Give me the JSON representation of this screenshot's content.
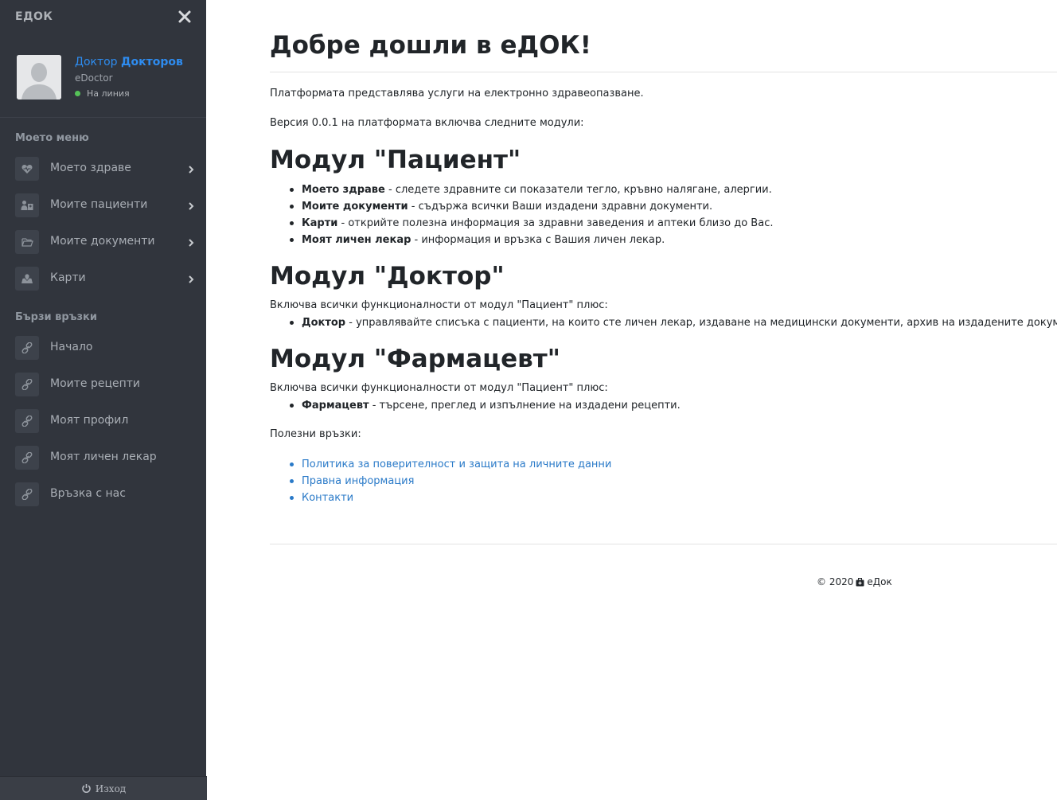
{
  "sidebar": {
    "brand": "ЕДОК",
    "profile": {
      "first_name": "Доктор",
      "last_name": "Докторов",
      "role": "eDoctor",
      "status": "На линия"
    },
    "menu_title": "Моето меню",
    "menu_items": [
      {
        "label": "Моето здраве",
        "icon": "heart-icon"
      },
      {
        "label": "Моите пациенти",
        "icon": "patients-icon"
      },
      {
        "label": "Моите документи",
        "icon": "folder-icon"
      },
      {
        "label": "Карти",
        "icon": "map-icon"
      }
    ],
    "links_title": "Бързи връзки",
    "quick_links": [
      {
        "label": "Начало",
        "icon": "link-icon"
      },
      {
        "label": "Моите рецепти",
        "icon": "link-icon"
      },
      {
        "label": "Моят профил",
        "icon": "link-icon"
      },
      {
        "label": "Моят личен лекар",
        "icon": "link-icon"
      },
      {
        "label": "Връзка с нас",
        "icon": "link-icon"
      }
    ],
    "logout": "Изход"
  },
  "main": {
    "title": "Добре дошли в еДОК!",
    "intro": "Платформата представлява услуги на електронно здравеопазване.",
    "version_text": "Версия 0.0.1 на платформата включва следните модули:",
    "patient_module": {
      "title": "Модул \"Пациент\"",
      "items": [
        {
          "bold": "Моето здраве",
          "text": " - следете здравните си показатели тегло, кръвно налягане, алергии."
        },
        {
          "bold": "Моите документи",
          "text": " - съдържа всички Ваши издадени здравни документи."
        },
        {
          "bold": "Карти",
          "text": " - открийте полезна информация за здравни заведения и аптеки близо до Вас."
        },
        {
          "bold": "Моят личен лекар",
          "text": " - информация и връзка с Вашия личен лекар."
        }
      ]
    },
    "doctor_module": {
      "title": "Модул \"Доктор\"",
      "intro": "Включва всички функционалности от модул \"Пациент\" плюс:",
      "items": [
        {
          "bold": "Доктор",
          "text": " - управлявайте списъка с пациенти, на които сте личен лекар, издаване на медицински документи, архив на издадените документи."
        }
      ]
    },
    "pharmacist_module": {
      "title": "Модул \"Фармацевт\"",
      "intro": "Включва всички функционалности от модул \"Пациент\" плюс:",
      "items": [
        {
          "bold": "Фармацевт",
          "text": " - търсене, преглед и изпълнение на издадени рецепти."
        }
      ]
    },
    "useful_links_title": "Полезни връзки:",
    "useful_links": [
      "Политика за поверителност и защита на личните данни",
      "Правна информация",
      "Контакти"
    ],
    "footer": {
      "copyright": "© 2020",
      "brand": "еДок"
    }
  }
}
